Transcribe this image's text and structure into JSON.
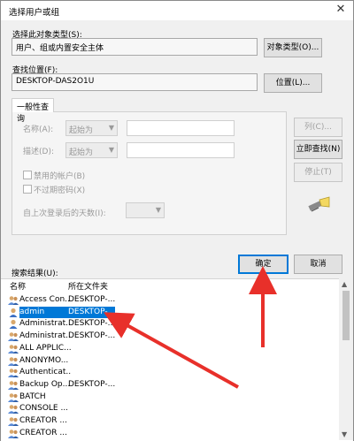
{
  "dialog": {
    "title": "选择用户或组",
    "close_symbol": "✕"
  },
  "object_type": {
    "label": "选择此对象类型(S):",
    "value": "用户、组或内置安全主体",
    "button": "对象类型(O)..."
  },
  "location": {
    "label": "查找位置(F):",
    "value": "DESKTOP-DAS2O1U",
    "button": "位置(L)..."
  },
  "general_query": {
    "tab_label": "一般性查询",
    "name_label": "名称(A):",
    "name_mode": "起始为",
    "desc_label": "描述(D):",
    "desc_mode": "起始为",
    "disabled_accounts": "禁用的帐户(B)",
    "non_expiring_pw": "不过期密码(X)",
    "days_since_login": "自上次登录后的天数(I):"
  },
  "side_buttons": {
    "columns": "列(C)...",
    "find_now": "立即查找(N)",
    "stop": "停止(T)"
  },
  "actions": {
    "ok": "确定",
    "cancel": "取消"
  },
  "results": {
    "label": "搜索结果(U):",
    "columns": [
      "名称",
      "所在文件夹"
    ],
    "rows": [
      {
        "name": "Access Con...",
        "folder": "DESKTOP-...",
        "icon": "group-icon",
        "selected": false
      },
      {
        "name": "admin",
        "folder": "DESKTOP-...",
        "icon": "user-icon",
        "selected": true
      },
      {
        "name": "Administrat...",
        "folder": "DESKTOP-...",
        "icon": "user-icon",
        "selected": false
      },
      {
        "name": "Administrat...",
        "folder": "DESKTOP-...",
        "icon": "group-icon",
        "selected": false
      },
      {
        "name": "ALL APPLIC...",
        "folder": "",
        "icon": "group-icon",
        "selected": false
      },
      {
        "name": "ANONYMO...",
        "folder": "",
        "icon": "group-icon",
        "selected": false
      },
      {
        "name": "Authenticat...",
        "folder": "",
        "icon": "group-icon",
        "selected": false
      },
      {
        "name": "Backup Op...",
        "folder": "DESKTOP-...",
        "icon": "group-icon",
        "selected": false
      },
      {
        "name": "BATCH",
        "folder": "",
        "icon": "group-icon",
        "selected": false
      },
      {
        "name": "CONSOLE ...",
        "folder": "",
        "icon": "group-icon",
        "selected": false
      },
      {
        "name": "CREATOR ...",
        "folder": "",
        "icon": "group-icon",
        "selected": false
      },
      {
        "name": "CREATOR ...",
        "folder": "",
        "icon": "group-icon",
        "selected": false
      }
    ]
  },
  "colors": {
    "selection": "#0078d7",
    "annotation_arrow": "#e8302a"
  }
}
